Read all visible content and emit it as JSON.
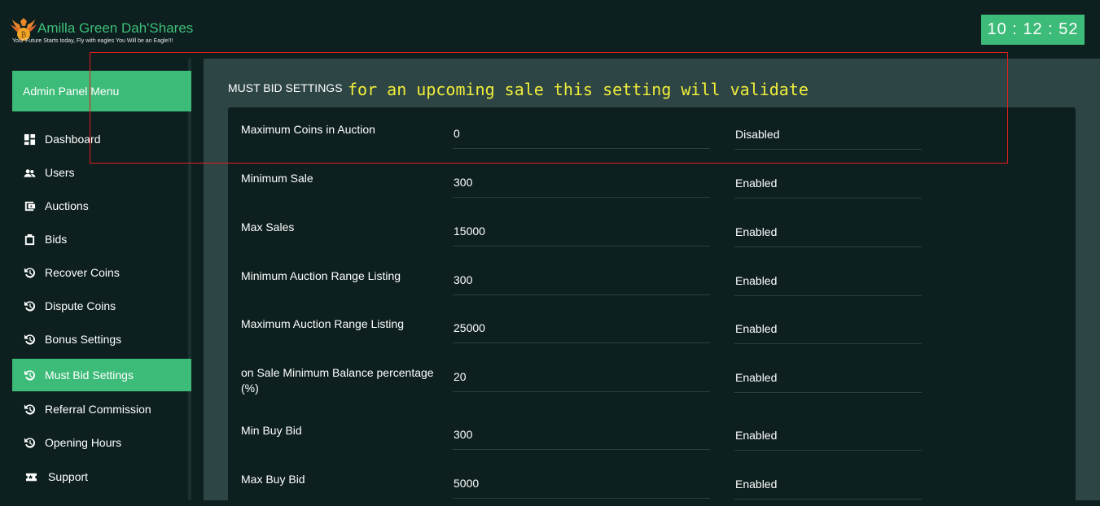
{
  "brand": {
    "title": "Amilla Green Dah'Shares",
    "tagline": "Your Future Starts today, Fly with eagles You Will be an Eagle!!!",
    "accent_color": "#3dbb79"
  },
  "clock": {
    "time": "10 : 12 : 52"
  },
  "sidebar": {
    "header": "Admin Panel Menu",
    "items": [
      {
        "label": "Dashboard",
        "icon": "dashboard-icon"
      },
      {
        "label": "Users",
        "icon": "users-icon"
      },
      {
        "label": "Auctions",
        "icon": "wallet-icon"
      },
      {
        "label": "Bids",
        "icon": "clipboard-icon"
      },
      {
        "label": "Recover Coins",
        "icon": "history-icon"
      },
      {
        "label": "Dispute Coins",
        "icon": "history-icon"
      },
      {
        "label": "Bonus Settings",
        "icon": "history-icon"
      },
      {
        "label": "Must Bid Settings",
        "icon": "history-icon",
        "active": true
      },
      {
        "label": "Referral Commission",
        "icon": "history-icon"
      },
      {
        "label": "Opening Hours",
        "icon": "history-icon"
      },
      {
        "label": "Support",
        "icon": "ticket-icon"
      }
    ]
  },
  "main": {
    "section_title": "MUST BID SETTINGS",
    "annotation": "for an upcoming sale this setting will validate",
    "settings": [
      {
        "label": "Maximum Coins in Auction",
        "value": "0",
        "status": "Disabled"
      },
      {
        "label": "Minimum Sale",
        "value": "300",
        "status": "Enabled"
      },
      {
        "label": "Max Sales",
        "value": "15000",
        "status": "Enabled"
      },
      {
        "label": "Minimum Auction Range Listing",
        "value": "300",
        "status": "Enabled"
      },
      {
        "label": "Maximum Auction Range Listing",
        "value": "25000",
        "status": "Enabled"
      },
      {
        "label": "on Sale Minimum Balance percentage (%)",
        "value": "20",
        "status": "Enabled"
      },
      {
        "label": "Min Buy Bid",
        "value": "300",
        "status": "Enabled"
      },
      {
        "label": "Max Buy Bid",
        "value": "5000",
        "status": "Enabled"
      }
    ]
  }
}
